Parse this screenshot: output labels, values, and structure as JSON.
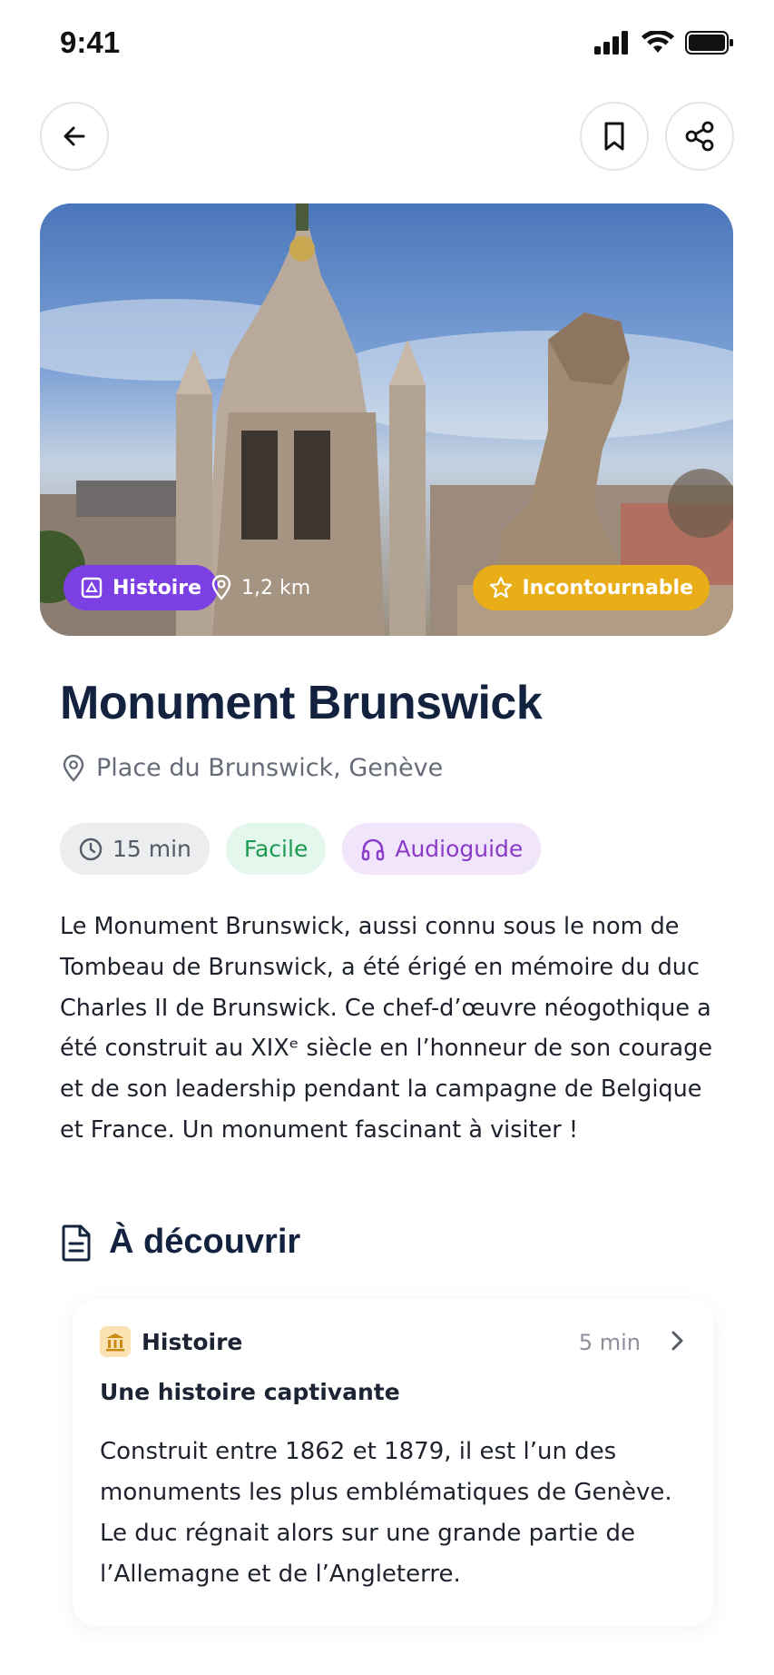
{
  "status_bar": {
    "time": "9:41"
  },
  "hero": {
    "chips": {
      "category": "Histoire",
      "distance": "1,2 km",
      "badge": "Incontournable"
    },
    "colors": {
      "category": "#7b3fe4",
      "badge": "#e9ad17"
    }
  },
  "place": {
    "title": "Monument Brunswick",
    "address": "Place du Brunswick, Genève"
  },
  "tags": {
    "duration": "15 min",
    "difficulty": "Facile",
    "audio": "Audioguide"
  },
  "description": "Le Monument Brunswick, aussi connu sous le nom de Tombeau de Brunswick, a été érigé en mémoire du duc Charles II de Brunswick. Ce chef-d’œuvre néogothique a été construit au XIXᵉ siècle en l’honneur de son courage et de son leadership pendant la campagne de Belgique et France. Un monument fascinant à visiter !",
  "discover": {
    "heading": "À découvrir",
    "card": {
      "category": "Histoire",
      "duration": "5 min",
      "subtitle": "Une histoire captivante",
      "text": "Construit entre 1862 et 1879, il est l’un des monuments les plus emblématiques de Genève. Le duc régnait alors sur une grande partie de l’Allemagne et de l’Angleterre."
    }
  },
  "icons": [
    "back-arrow-icon",
    "bookmark-icon",
    "share-icon",
    "location-pin-icon",
    "clock-icon",
    "headphones-icon",
    "document-icon",
    "museum-icon",
    "chevron-right-icon",
    "star-icon"
  ]
}
